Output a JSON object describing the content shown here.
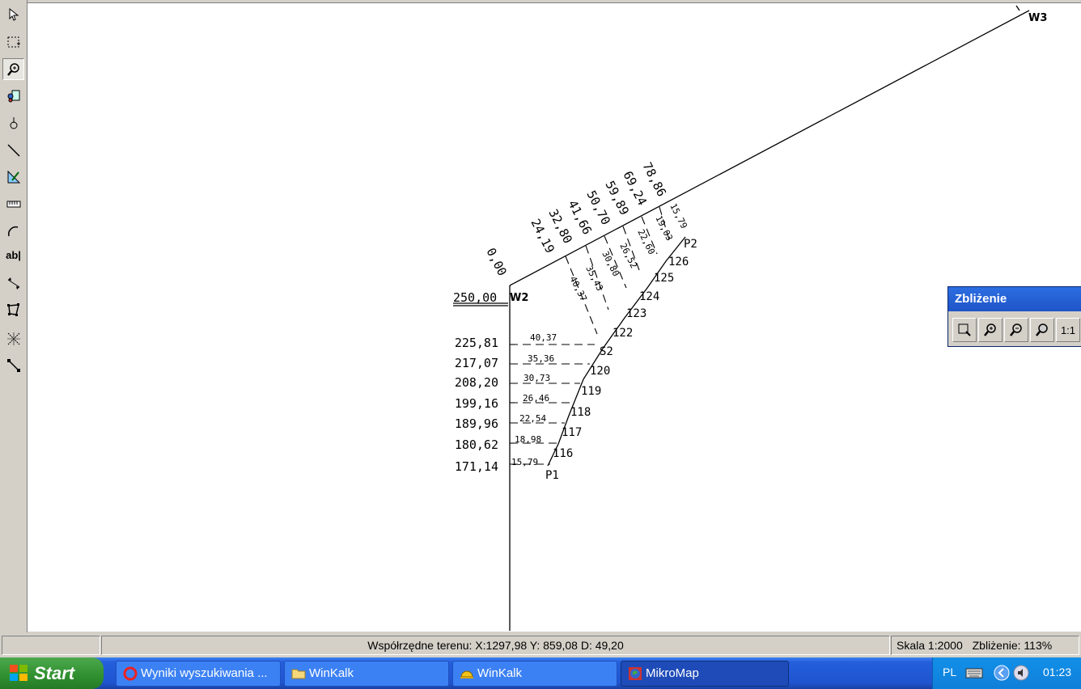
{
  "toolbar": {
    "tools": [
      {
        "name": "select-arrow-icon"
      },
      {
        "name": "rect-select-icon"
      },
      {
        "name": "zoom-icon",
        "active": true
      },
      {
        "name": "layers-icon"
      },
      {
        "name": "point-icon"
      },
      {
        "name": "line-icon"
      },
      {
        "name": "measure-icon"
      },
      {
        "name": "ruler-icon"
      },
      {
        "name": "arc-icon"
      },
      {
        "name": "text-tool-icon",
        "label": "ab|"
      },
      {
        "name": "dimension-icon"
      },
      {
        "name": "polygon-icon"
      },
      {
        "name": "intersect-icon"
      },
      {
        "name": "segment-icon"
      }
    ]
  },
  "drawing": {
    "stations": [
      "W2",
      "W3",
      "P1",
      "P2",
      "S2"
    ],
    "w2_chainage": "250,00",
    "left_chainages": [
      "225,81",
      "217,07",
      "208,20",
      "199,16",
      "189,96",
      "180,62",
      "171,14"
    ],
    "left_offsets": [
      "40,37",
      "35,36",
      "30,73",
      "26,46",
      "22,54",
      "18,98",
      "15,79"
    ],
    "diag_chainages": [
      "0,00",
      "24,19",
      "32,80",
      "41,66",
      "50,70",
      "59,89",
      "69,24",
      "78,86"
    ],
    "diag_offsets": [
      "40,37",
      "35,43",
      "30,80",
      "26,52",
      "22,60",
      "19,03",
      "15,79"
    ],
    "curve_points": [
      "116",
      "117",
      "118",
      "119",
      "120",
      "122",
      "123",
      "124",
      "125",
      "126"
    ]
  },
  "zoom_panel": {
    "title": "Zbliżenie",
    "buttons": [
      "zoom-window-icon",
      "zoom-in-icon",
      "zoom-out-icon",
      "zoom-all-icon"
    ],
    "one_to_one": "1:1"
  },
  "status": {
    "coords": "Współrzędne terenu: X:1297,98 Y: 859,08  D: 49,20",
    "scale": "Skala 1:2000",
    "zoom": "Zbliżenie: 113%"
  },
  "taskbar": {
    "start": "Start",
    "tasks": [
      {
        "label": "Wyniki wyszukiwania ...",
        "icon": "opera-icon"
      },
      {
        "label": "WinKalk",
        "icon": "folder-icon"
      },
      {
        "label": "WinKalk",
        "icon": "helmet-icon"
      },
      {
        "label": "MikroMap",
        "icon": "globe-icon",
        "active": true
      }
    ],
    "lang": "PL",
    "time": "01:23"
  }
}
